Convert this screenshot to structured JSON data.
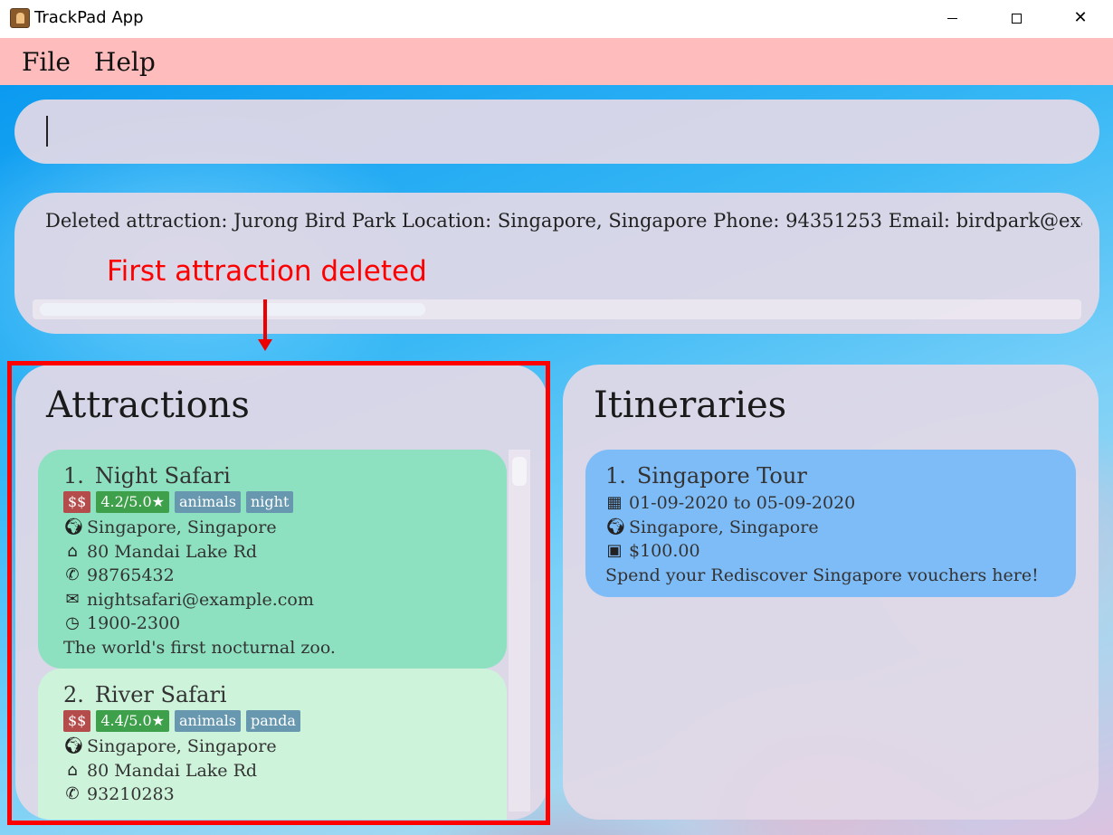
{
  "window": {
    "title": "TrackPad App",
    "close_glyph": "✕"
  },
  "menu": [
    "File",
    "Help"
  ],
  "command_box": {
    "value": ""
  },
  "result_display": {
    "text": "Deleted attraction: Jurong Bird Park Location: Singapore, Singapore Phone: 94351253 Email: birdpark@example.com"
  },
  "annotation": {
    "text": "First attraction deleted",
    "color": "#ff0000"
  },
  "attractions": {
    "title": "Attractions",
    "items": [
      {
        "index": "1.",
        "name": "Night Safari",
        "price": "$$",
        "rating": "4.2/5.0★",
        "tags": [
          "animals",
          "night"
        ],
        "location": "Singapore, Singapore",
        "address": "80 Mandai Lake Rd",
        "phone": "98765432",
        "email": "nightsafari@example.com",
        "hours": "1900-2300",
        "description": "The world's first nocturnal zoo."
      },
      {
        "index": "2.",
        "name": "River Safari",
        "price": "$$",
        "rating": "4.4/5.0★",
        "tags": [
          "animals",
          "panda"
        ],
        "location": "Singapore, Singapore",
        "address": "80 Mandai Lake Rd",
        "phone": "93210283"
      }
    ]
  },
  "itineraries": {
    "title": "Itineraries",
    "items": [
      {
        "index": "1.",
        "name": "Singapore Tour",
        "dates": "01-09-2020 to 05-09-2020",
        "location": "Singapore, Singapore",
        "budget": "$100.00",
        "description": "Spend your Rediscover Singapore vouchers here!"
      }
    ]
  },
  "icons": {
    "location": "globe-icon",
    "address": "home-icon",
    "phone": "phone-icon",
    "email": "email-icon",
    "hours": "clock-icon",
    "dates": "calendar-icon",
    "budget": "money-icon"
  },
  "colors": {
    "menubar": "#ffbcbc",
    "card_selected": "#8ee1c0",
    "card_normal": "#cdf3da",
    "itinerary_card": "#7ebcf8",
    "tag_price": "#b44c4c",
    "tag_rating": "#3ea04a",
    "tag_label": "#6898b0",
    "highlight_border": "#ff0000"
  }
}
